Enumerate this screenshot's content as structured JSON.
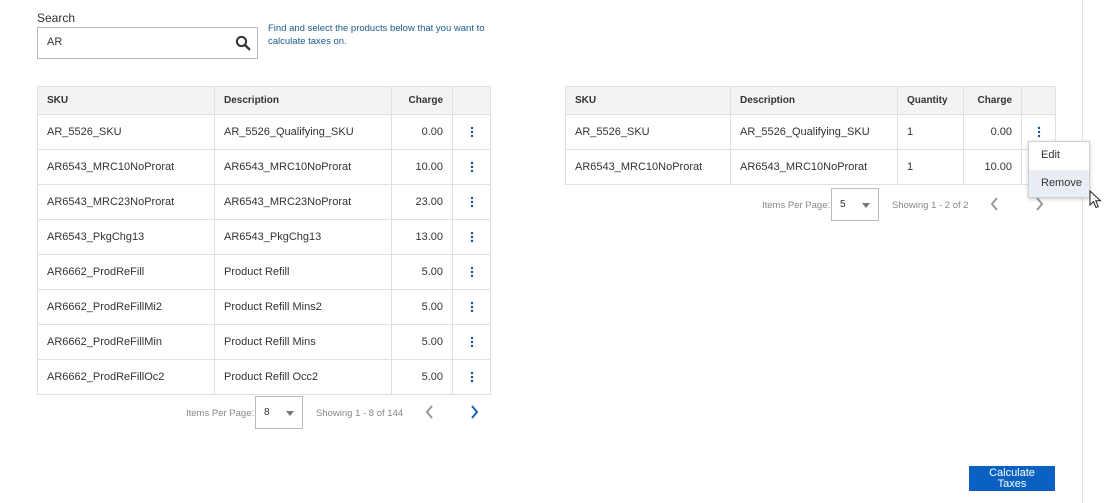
{
  "search": {
    "label": "Search",
    "value": "AR",
    "hint": "Find and select the products below that you want to calculate taxes on."
  },
  "left_table": {
    "headers": {
      "sku": "SKU",
      "description": "Description",
      "charge": "Charge"
    },
    "rows": [
      {
        "sku": "AR_5526_SKU",
        "description": "AR_5526_Qualifying_SKU",
        "charge": "0.00"
      },
      {
        "sku": "AR6543_MRC10NoProrat",
        "description": "AR6543_MRC10NoProrat",
        "charge": "10.00"
      },
      {
        "sku": "AR6543_MRC23NoProrat",
        "description": "AR6543_MRC23NoProrat",
        "charge": "23.00"
      },
      {
        "sku": "AR6543_PkgChg13",
        "description": "AR6543_PkgChg13",
        "charge": "13.00"
      },
      {
        "sku": "AR6662_ProdReFill",
        "description": "Product Refill",
        "charge": "5.00"
      },
      {
        "sku": "AR6662_ProdReFillMi2",
        "description": "Product Refill Mins2",
        "charge": "5.00"
      },
      {
        "sku": "AR6662_ProdReFillMin",
        "description": "Product Refill Mins",
        "charge": "5.00"
      },
      {
        "sku": "AR6662_ProdReFillOc2",
        "description": "Product Refill Occ2",
        "charge": "5.00"
      }
    ],
    "pager": {
      "items_per_page_label": "Items Per Page:",
      "items_per_page": "8",
      "showing": "Showing 1 - 8 of 144"
    }
  },
  "right_table": {
    "headers": {
      "sku": "SKU",
      "description": "Description",
      "quantity": "Quantity",
      "charge": "Charge"
    },
    "rows": [
      {
        "sku": "AR_5526_SKU",
        "description": "AR_5526_Qualifying_SKU",
        "quantity": "1",
        "charge": "0.00"
      },
      {
        "sku": "AR6543_MRC10NoProrat",
        "description": "AR6543_MRC10NoProrat",
        "quantity": "1",
        "charge": "10.00"
      }
    ],
    "pager": {
      "items_per_page_label": "Items Per Page:",
      "items_per_page": "5",
      "showing": "Showing 1 - 2 of 2"
    }
  },
  "context_menu": {
    "items": [
      "Edit",
      "Remove"
    ],
    "hovered": "Remove"
  },
  "actions": {
    "calculate_line1": "Calculate",
    "calculate_line2": "Taxes"
  },
  "colors": {
    "primary": "#0a61c1",
    "link": "#1a5a8a",
    "header_bg": "#f3f3f3",
    "menu_hover": "#e9eef5"
  }
}
